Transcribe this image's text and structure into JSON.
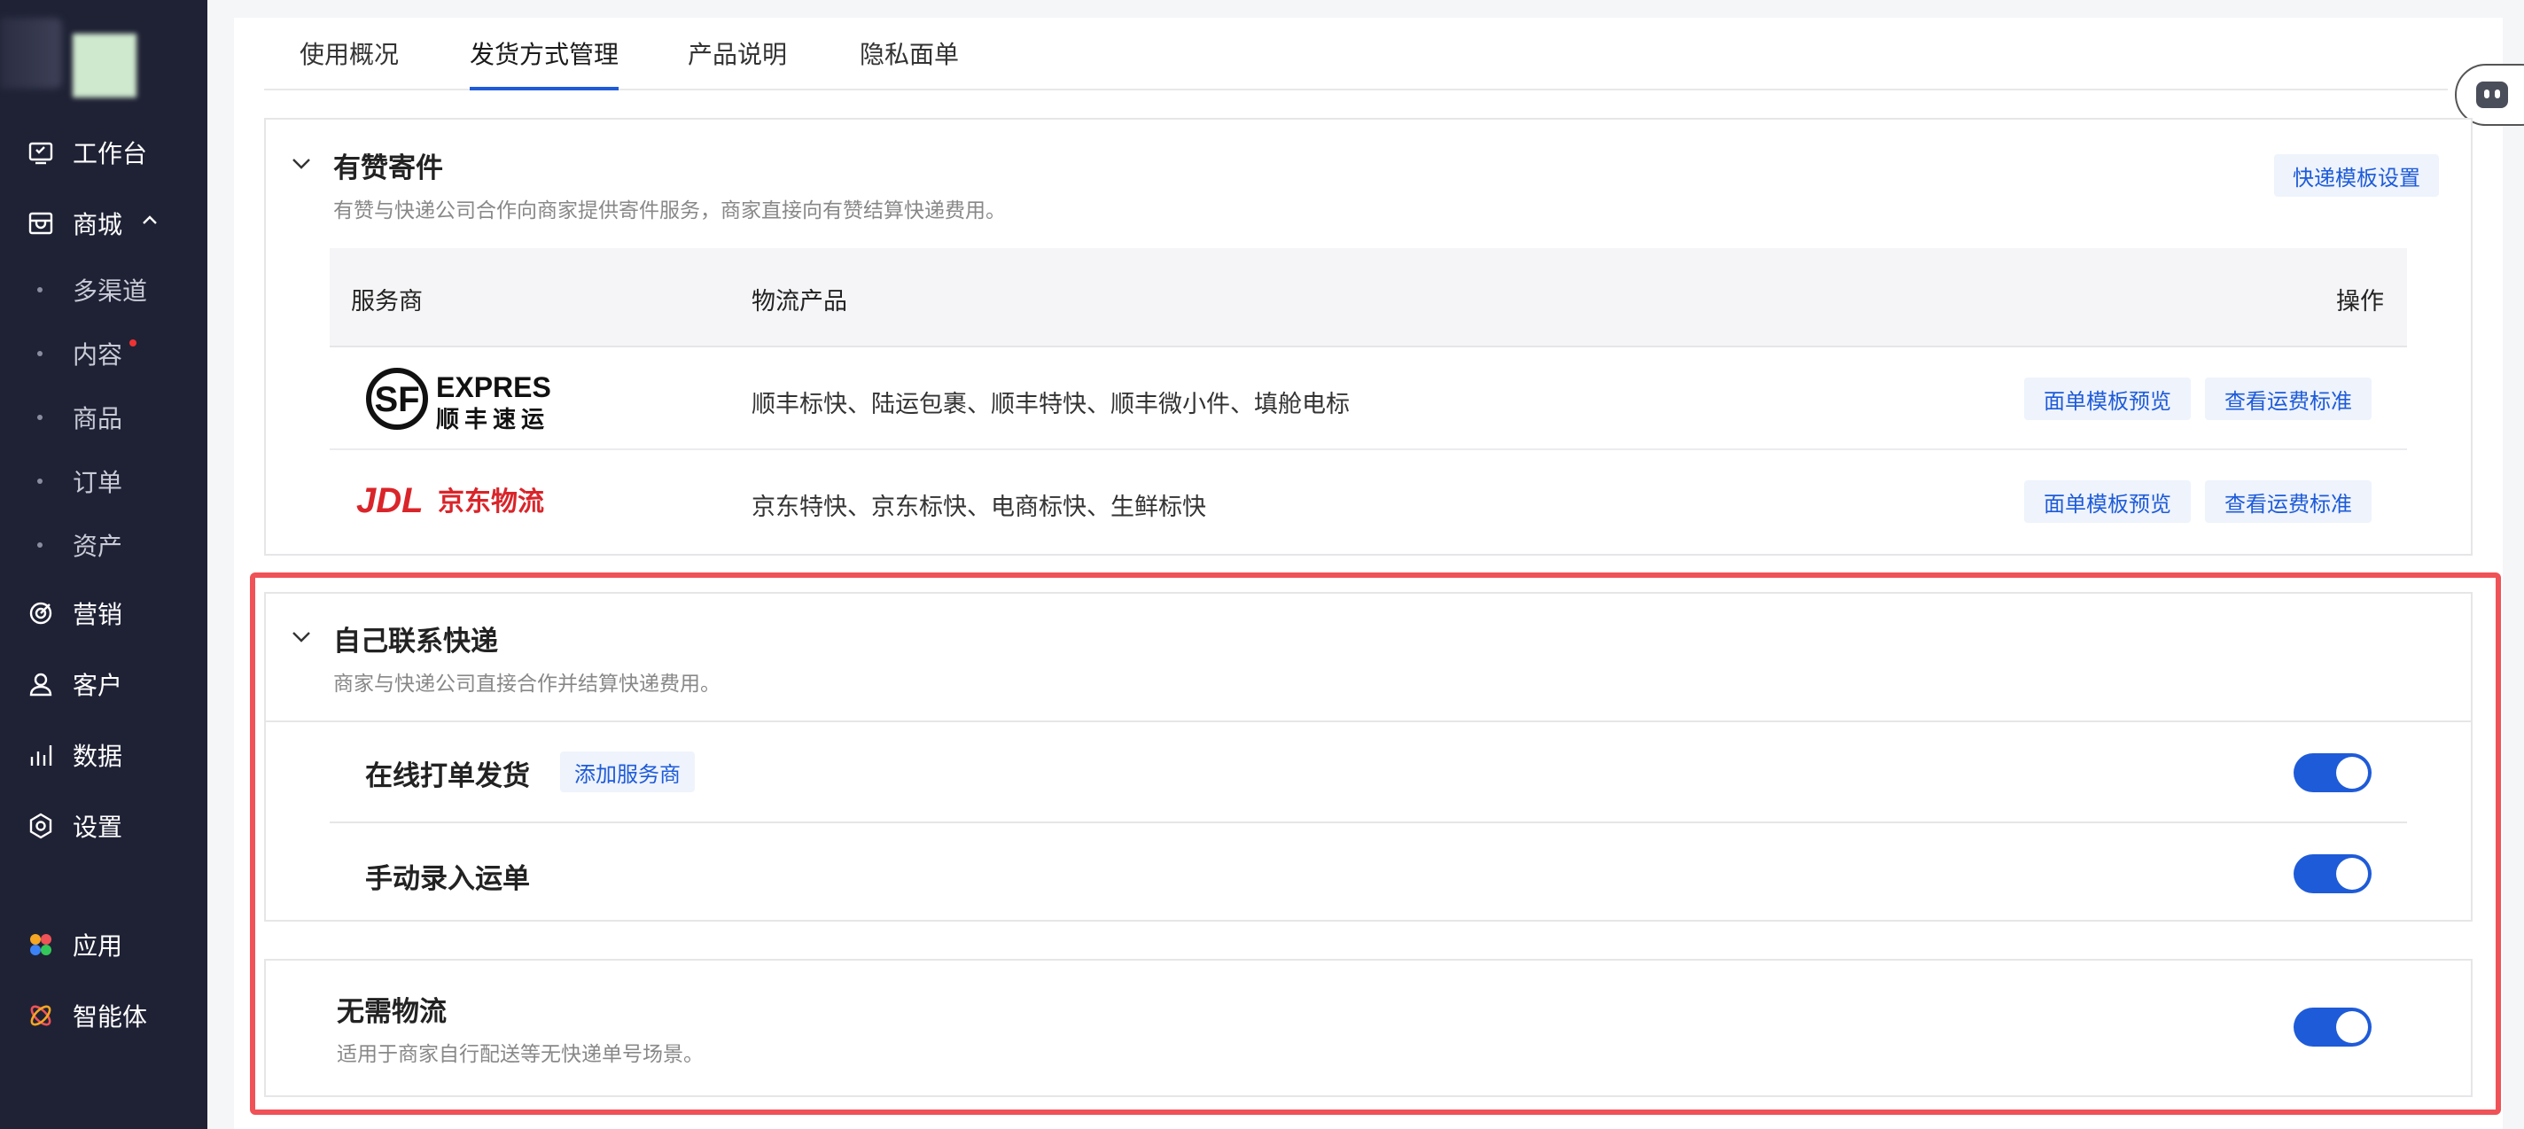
{
  "sidebar": {
    "items": [
      {
        "label": "工作台",
        "icon": "workbench-icon"
      },
      {
        "label": "商城",
        "icon": "store-icon"
      },
      {
        "label": "营销",
        "icon": "marketing-icon"
      },
      {
        "label": "客户",
        "icon": "customer-icon"
      },
      {
        "label": "数据",
        "icon": "data-icon"
      },
      {
        "label": "设置",
        "icon": "settings-icon"
      },
      {
        "label": "应用",
        "icon": "apps-icon"
      },
      {
        "label": "智能体",
        "icon": "agent-icon"
      }
    ],
    "sub_items": [
      "多渠道",
      "内容",
      "商品",
      "订单",
      "资产"
    ]
  },
  "tabs": [
    {
      "label": "使用概况"
    },
    {
      "label": "发货方式管理"
    },
    {
      "label": "产品说明"
    },
    {
      "label": "隐私面单"
    }
  ],
  "youzan": {
    "title": "有赞寄件",
    "desc": "有赞与快递公司合作向商家提供寄件服务，商家直接向有赞结算快递费用。",
    "template_btn": "快递模板设置",
    "table": {
      "headers": [
        "服务商",
        "物流产品",
        "操作"
      ],
      "rows": [
        {
          "logo_alt": "SF EXPRESS 顺丰速运",
          "sf_text_en": "EXPRESS",
          "sf_text_cn": "顺丰速运",
          "products": "顺丰标快、陆运包裹、顺丰特快、顺丰微小件、填舱电标",
          "action1": "面单模板预览",
          "action2": "查看运费标准"
        },
        {
          "logo_alt": "JDL 京东物流",
          "jdl_text_en": "JDL",
          "jdl_text_cn": "京东物流",
          "products": "京东特快、京东标快、电商标快、生鲜标快",
          "action1": "面单模板预览",
          "action2": "查看运费标准"
        }
      ]
    }
  },
  "self_express": {
    "title": "自己联系快递",
    "desc": "商家与快递公司直接合作并结算快递费用。",
    "online": {
      "title": "在线打单发货",
      "add_btn": "添加服务商",
      "enabled": true
    },
    "manual": {
      "title": "手动录入运单",
      "enabled": true
    }
  },
  "no_logistics": {
    "title": "无需物流",
    "desc": "适用于商家自行配送等无快递单号场景。",
    "enabled": true
  },
  "colors": {
    "accent": "#1e5bd8",
    "highlight": "#ef5257",
    "sidebar": "#1f2235"
  }
}
